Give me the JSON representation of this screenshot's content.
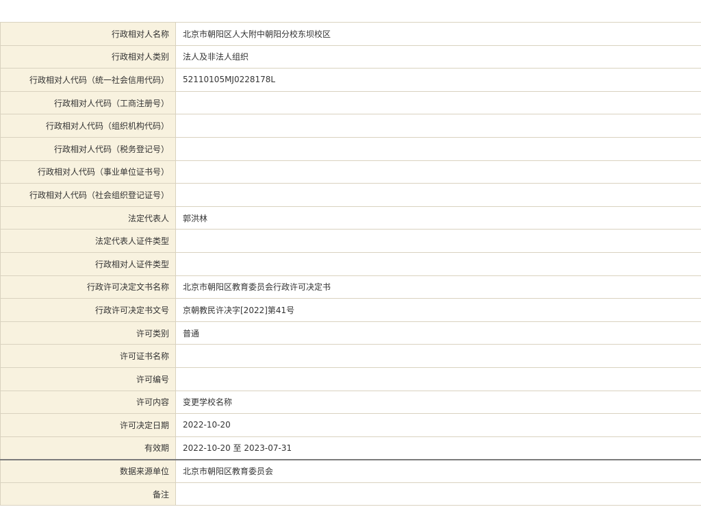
{
  "record": {
    "rows": [
      {
        "label": "行政相对人名称",
        "value": "北京市朝阳区人大附中朝阳分校东坝校区"
      },
      {
        "label": "行政相对人类别",
        "value": "法人及非法人组织"
      },
      {
        "label": "行政相对人代码（统一社会信用代码）",
        "value": "52110105MJ0228178L"
      },
      {
        "label": "行政相对人代码（工商注册号）",
        "value": ""
      },
      {
        "label": "行政相对人代码（组织机构代码）",
        "value": ""
      },
      {
        "label": "行政相对人代码（税务登记号）",
        "value": ""
      },
      {
        "label": "行政相对人代码（事业单位证书号）",
        "value": ""
      },
      {
        "label": "行政相对人代码（社会组织登记证号）",
        "value": ""
      },
      {
        "label": "法定代表人",
        "value": "郭洪林"
      },
      {
        "label": "法定代表人证件类型",
        "value": ""
      },
      {
        "label": "行政相对人证件类型",
        "value": ""
      },
      {
        "label": "行政许可决定文书名称",
        "value": "北京市朝阳区教育委员会行政许可决定书"
      },
      {
        "label": "行政许可决定书文号",
        "value": "京朝教民许决字[2022]第41号"
      },
      {
        "label": "许可类别",
        "value": "普通"
      },
      {
        "label": "许可证书名称",
        "value": ""
      },
      {
        "label": "许可编号",
        "value": ""
      },
      {
        "label": "许可内容",
        "value": "变更学校名称"
      },
      {
        "label": "许可决定日期",
        "value": "2022-10-20"
      },
      {
        "label": "有效期",
        "value": "2022-10-20 至 2023-07-31"
      },
      {
        "label": "数据来源单位",
        "value": "北京市朝阳区教育委员会"
      },
      {
        "label": "备注",
        "value": ""
      }
    ]
  }
}
